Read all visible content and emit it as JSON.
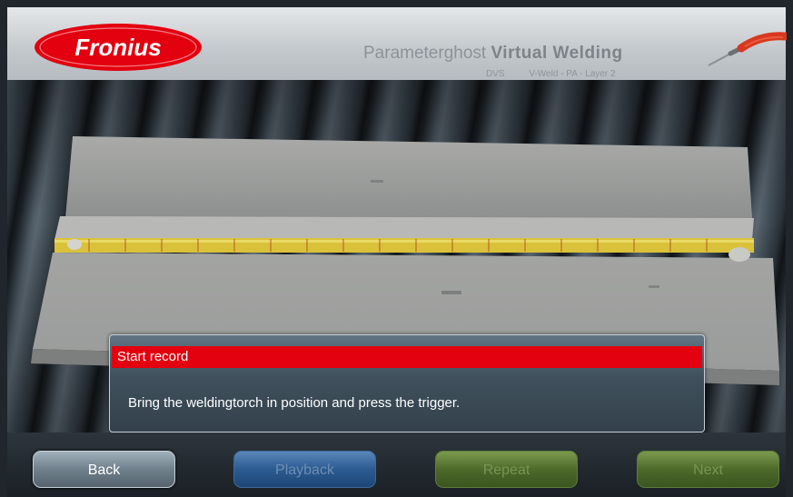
{
  "header": {
    "brand": "Fronius",
    "title_light": "Parameterghost",
    "title_bold": "Virtual Welding",
    "subtitle_left": "DVS",
    "subtitle_right": "V-Weld - PA - Layer 2"
  },
  "dialog": {
    "title": "Start record",
    "message": "Bring the weldingtorch in position and press the trigger."
  },
  "footer": {
    "back_label": "Back",
    "playback_label": "Playback",
    "repeat_label": "Repeat",
    "next_label": "Next"
  },
  "colors": {
    "brand_red": "#e3000f",
    "weld_seam": "#d9c23a"
  }
}
